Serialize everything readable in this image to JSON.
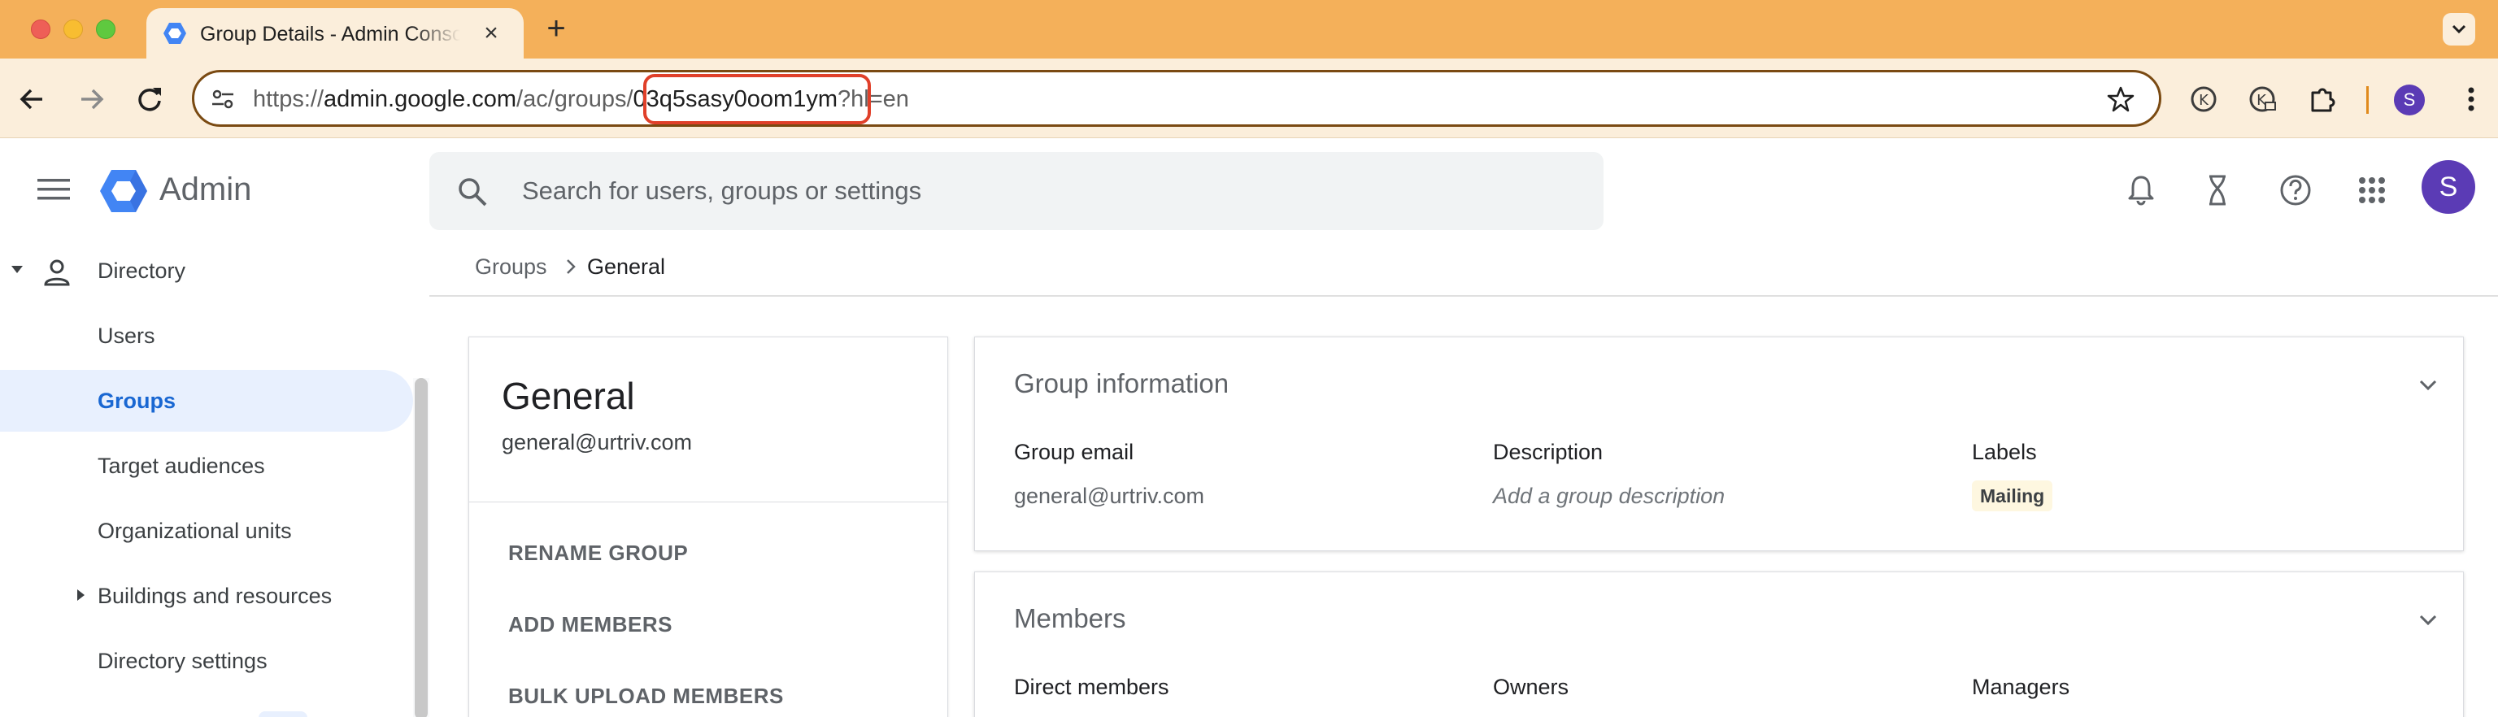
{
  "browser": {
    "tab": {
      "title": "Group Details - Admin Console",
      "close_glyph": "×"
    },
    "new_tab_glyph": "+",
    "url": {
      "prefix": "https://",
      "host": "admin.google.com",
      "path_before": "/ac/groups/",
      "group_id": "03q5sasy0oom1ym",
      "query": "?hl=en"
    },
    "profile_initial": "S",
    "icons": [
      "back-icon",
      "forward-icon",
      "reload-icon",
      "site-info-icon",
      "star-icon",
      "extension-icon",
      "kebab-icon",
      "tab-search-icon"
    ]
  },
  "header": {
    "app_name": "Admin",
    "search_placeholder": "Search for users, groups or settings",
    "avatar_initial": "S",
    "colors": {
      "avatar": "#5b3bb5",
      "logo": "#4285f4"
    }
  },
  "sidebar": {
    "directory_label": "Directory",
    "items": [
      {
        "label": "Users",
        "selected": false
      },
      {
        "label": "Groups",
        "selected": true
      },
      {
        "label": "Target audiences",
        "selected": false
      },
      {
        "label": "Organizational units",
        "selected": false
      },
      {
        "label": "Buildings and resources",
        "selected": false
      },
      {
        "label": "Directory settings",
        "selected": false
      }
    ],
    "colors": {
      "selected_bg": "#e8f0fe",
      "selected_text": "#1967d2"
    }
  },
  "breadcrumb": {
    "parent": "Groups",
    "current": "General"
  },
  "group": {
    "name": "General",
    "email": "general@urtriv.com",
    "actions": [
      "RENAME GROUP",
      "ADD MEMBERS",
      "BULK UPLOAD MEMBERS"
    ]
  },
  "group_information": {
    "title": "Group information",
    "email_label": "Group email",
    "email_value": "general@urtriv.com",
    "description_label": "Description",
    "description_placeholder": "Add a group description",
    "labels_label": "Labels",
    "labels": [
      "Mailing"
    ]
  },
  "members": {
    "title": "Members",
    "direct_label": "Direct members",
    "owners_label": "Owners",
    "managers_label": "Managers"
  }
}
